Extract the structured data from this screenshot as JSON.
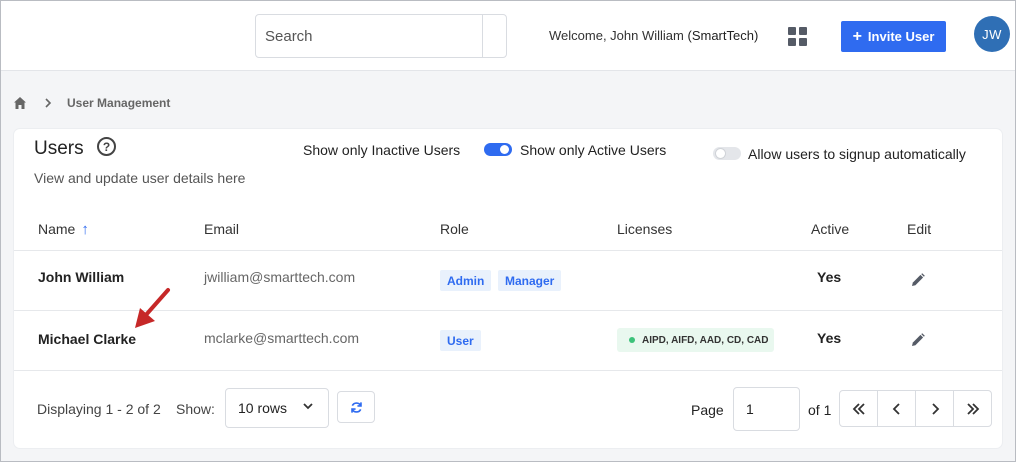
{
  "header": {
    "search_placeholder": "Search",
    "welcome_prefix": "Welcome, John William",
    "welcome_org": "(SmartTech)",
    "apps_icon": "grid-icon",
    "invite_button": "Invite User",
    "avatar_initials": "JW",
    "accent_color": "#2f6bf0"
  },
  "breadcrumb": {
    "home_icon": "home-icon",
    "separator_icon": "chevron-right-icon",
    "current": "User Management"
  },
  "users_panel": {
    "title": "Users",
    "help_icon": "question-circle-icon",
    "subtitle": "View and update user details here",
    "filters": {
      "inactive_label": "Show only Inactive Users",
      "active_label": "Show only Active Users",
      "active_toggle_on": true,
      "signup_label": "Allow users to signup automatically",
      "signup_toggle_on": false
    },
    "columns": [
      "Name",
      "Email",
      "Role",
      "Licenses",
      "Active",
      "Edit"
    ],
    "sort_icon": "arrow-up-icon",
    "rows": [
      {
        "name": "John William",
        "email": "jwilliam@smarttech.com",
        "roles": [
          "Admin",
          "Manager"
        ],
        "licenses": "",
        "active": "Yes",
        "edit_icon": "pencil-icon"
      },
      {
        "name": "Michael Clarke",
        "email": "mclarke@smarttech.com",
        "roles": [
          "User"
        ],
        "licenses": "AIPD, AIFD, AAD, CD, CAD",
        "active": "Yes",
        "edit_icon": "pencil-icon"
      }
    ],
    "footer": {
      "displaying": "Displaying 1 - 2 of 2",
      "show_label": "Show:",
      "rows_per_page": "10 rows",
      "refresh_icon": "refresh-icon",
      "page_label": "Page",
      "page_value": "1",
      "of_label": "of 1",
      "pager_icons": [
        "first-page-icon",
        "prev-page-icon",
        "next-page-icon",
        "last-page-icon"
      ]
    }
  },
  "annotation": {
    "arrow_color": "#c62828",
    "arrow_icon": "red-arrow-icon"
  }
}
